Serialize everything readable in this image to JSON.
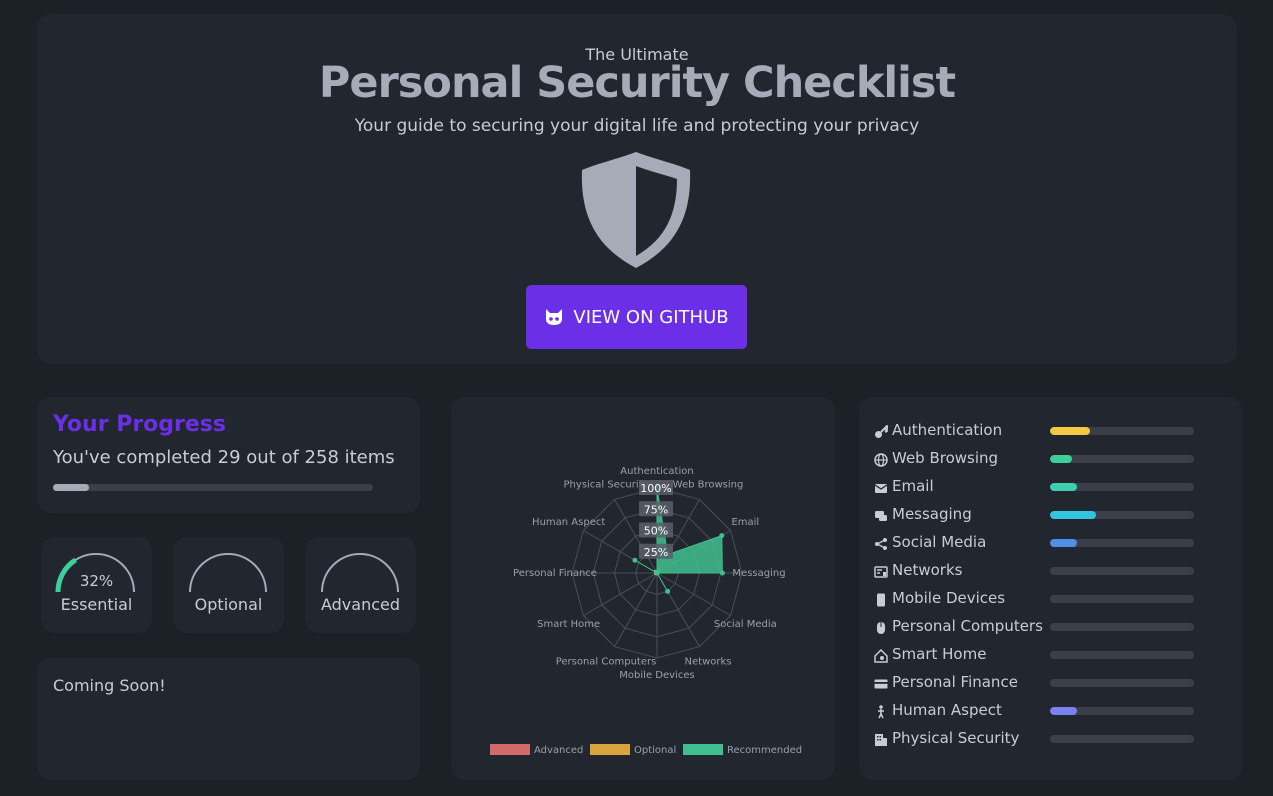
{
  "hero": {
    "eyebrow": "The Ultimate",
    "title": "Personal Security Checklist",
    "subtitle": "Your guide to securing your digital life and protecting your privacy",
    "github_button": "VIEW ON GITHUB"
  },
  "progress": {
    "title": "Your Progress",
    "text": "You've completed 29 out of 258 items",
    "completed": 29,
    "total": 258
  },
  "gauges": [
    {
      "label": "Essential",
      "percent_text": "32%",
      "percent": 32
    },
    {
      "label": "Optional",
      "percent_text": "",
      "percent": 0
    },
    {
      "label": "Advanced",
      "percent_text": "",
      "percent": 0
    }
  ],
  "coming_soon": "Coming Soon!",
  "chart_data": {
    "type": "radar",
    "axes": [
      "Authentication",
      "Web Browsing",
      "Email",
      "Messaging",
      "Social Media",
      "Networks",
      "Mobile Devices",
      "Personal Computers",
      "Smart Home",
      "Personal Finance",
      "Human Aspect",
      "Physical Security"
    ],
    "ticks": [
      "25%",
      "50%",
      "75%",
      "100%"
    ],
    "rlim": [
      0,
      100
    ],
    "series": [
      {
        "name": "Advanced",
        "color": "#d16b6b",
        "values": [
          0,
          0,
          0,
          0,
          0,
          0,
          0,
          0,
          0,
          0,
          0,
          0
        ]
      },
      {
        "name": "Optional",
        "color": "#d9a43b",
        "values": [
          0,
          0,
          0,
          0,
          0,
          0,
          0,
          0,
          0,
          0,
          0,
          0
        ]
      },
      {
        "name": "Recommended",
        "color": "#3fbf8f",
        "values": [
          100,
          25,
          88,
          77,
          0,
          25,
          0,
          0,
          0,
          0,
          30,
          0
        ]
      }
    ],
    "legend": "bottom"
  },
  "categories": [
    {
      "label": "Authentication",
      "icon": "key-icon",
      "progress": 0.28,
      "color": "#f5c842"
    },
    {
      "label": "Web Browsing",
      "icon": "globe-icon",
      "progress": 0.15,
      "color": "#3ecf99"
    },
    {
      "label": "Email",
      "icon": "envelope-icon",
      "progress": 0.19,
      "color": "#3ecfb0"
    },
    {
      "label": "Messaging",
      "icon": "chat-icon",
      "progress": 0.32,
      "color": "#33c4e0"
    },
    {
      "label": "Social Media",
      "icon": "share-icon",
      "progress": 0.19,
      "color": "#4f8fe8"
    },
    {
      "label": "Networks",
      "icon": "router-icon",
      "progress": 0,
      "color": "#4f8fe8"
    },
    {
      "label": "Mobile Devices",
      "icon": "phone-icon",
      "progress": 0,
      "color": "#4f8fe8"
    },
    {
      "label": "Personal Computers",
      "icon": "mouse-icon",
      "progress": 0,
      "color": "#4f8fe8"
    },
    {
      "label": "Smart Home",
      "icon": "smart-home-icon",
      "progress": 0,
      "color": "#4f8fe8"
    },
    {
      "label": "Personal Finance",
      "icon": "credit-card-icon",
      "progress": 0,
      "color": "#4f8fe8"
    },
    {
      "label": "Human Aspect",
      "icon": "person-icon",
      "progress": 0.19,
      "color": "#7b82f0"
    },
    {
      "label": "Physical Security",
      "icon": "building-icon",
      "progress": 0,
      "color": "#4f8fe8"
    }
  ]
}
